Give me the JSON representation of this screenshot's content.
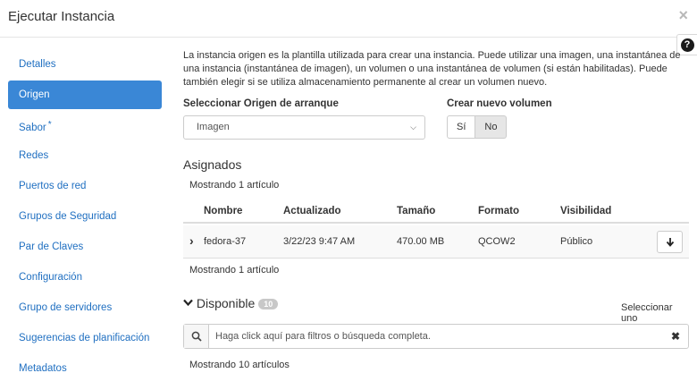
{
  "window": {
    "title": "Ejecutar Instancia",
    "close_glyph": "×",
    "help_glyph": "?"
  },
  "sidebar": {
    "items": [
      {
        "label": "Detalles"
      },
      {
        "label": "Origen",
        "active": true
      },
      {
        "label": "Sabor",
        "required_mark": "*"
      },
      {
        "label": "Redes"
      },
      {
        "label": "Puertos de red"
      },
      {
        "label": "Grupos de Seguridad"
      },
      {
        "label": "Par de Claves"
      },
      {
        "label": "Configuración"
      },
      {
        "label": "Grupo de servidores"
      },
      {
        "label": "Sugerencias de planificación"
      },
      {
        "label": "Metadatos"
      }
    ]
  },
  "main": {
    "description": "La instancia origen es la plantilla utilizada para crear una instancia. Puede utilizar una imagen, una instantánea de una instancia (instantánea de imagen), un volumen o una instantánea de volumen (si están habilitadas). Puede también elegir si se utiliza almacenamiento permanente al crear un volumen nuevo.",
    "boot_source_label": "Seleccionar Origen de arranque",
    "boot_source_value": "Imagen",
    "new_volume_label": "Crear nuevo volumen",
    "new_volume_yes": "Sí",
    "new_volume_no": "No",
    "new_volume_selected": "No",
    "allocated_title": "Asignados",
    "allocated_count_top": "Mostrando 1 artículo",
    "allocated_count_bottom": "Mostrando 1 artículo",
    "columns": [
      "Nombre",
      "Actualizado",
      "Tamaño",
      "Formato",
      "Visibilidad"
    ],
    "rows": [
      {
        "name": "fedora-37",
        "updated": "3/22/23 9:47 AM",
        "size": "470.00 MB",
        "format": "QCOW2",
        "visibility": "Público"
      }
    ],
    "available_title": "Disponible",
    "available_badge": "10",
    "select_one": "Seleccionar uno",
    "search_placeholder": "Haga click aquí para filtros o búsqueda completa.",
    "available_count": "Mostrando 10 artículos"
  },
  "icons": {
    "search": "search-icon",
    "clear": "clear-icon",
    "row_expand": "chevron-right-icon",
    "move_down": "arrow-down-icon",
    "collapse": "chevron-down-icon"
  }
}
